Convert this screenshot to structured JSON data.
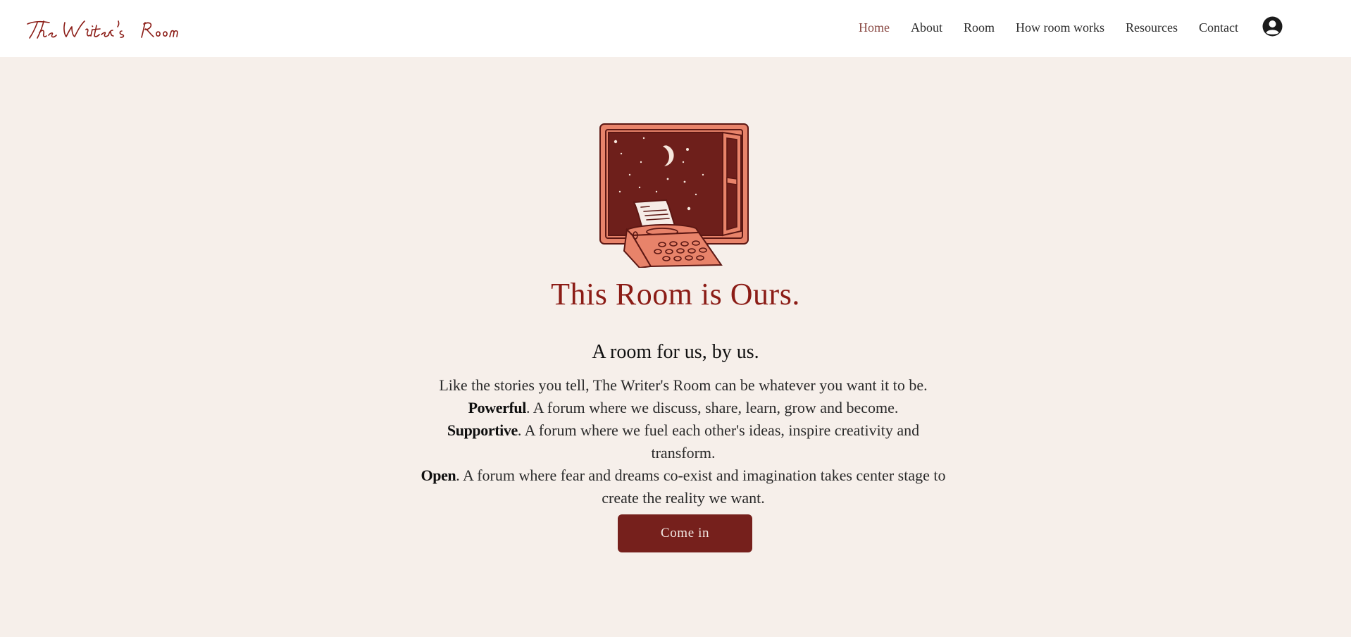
{
  "header": {
    "logo_text": "The Writer's Room",
    "nav": [
      {
        "label": "Home",
        "active": true
      },
      {
        "label": "About",
        "active": false
      },
      {
        "label": "Room",
        "active": false
      },
      {
        "label": "How room works",
        "active": false
      },
      {
        "label": "Resources",
        "active": false
      },
      {
        "label": "Contact",
        "active": false
      }
    ],
    "account_icon": "account-avatar-icon"
  },
  "hero": {
    "illustration": "window-night-typewriter-illustration",
    "title": "This Room is Ours.",
    "subtitle": "A room for us, by us.",
    "intro": "Like the stories you tell, The Writer's Room can be whatever you want it to be.",
    "points": [
      {
        "term": "Powerful",
        "text": ". A forum where we discuss, share, learn, grow and become."
      },
      {
        "term": "Supportive",
        "text": ". A forum where we fuel each other's ideas, inspire creativity and transform."
      },
      {
        "term": "Open",
        "text": ". A forum where fear and dreams co-exist and imagination takes center stage to create the reality we want."
      }
    ],
    "cta_label": "Come in"
  },
  "colors": {
    "accent": "#8b1c16",
    "button": "#76201c",
    "background": "#f6efea",
    "nav_active": "#8a4a44"
  }
}
